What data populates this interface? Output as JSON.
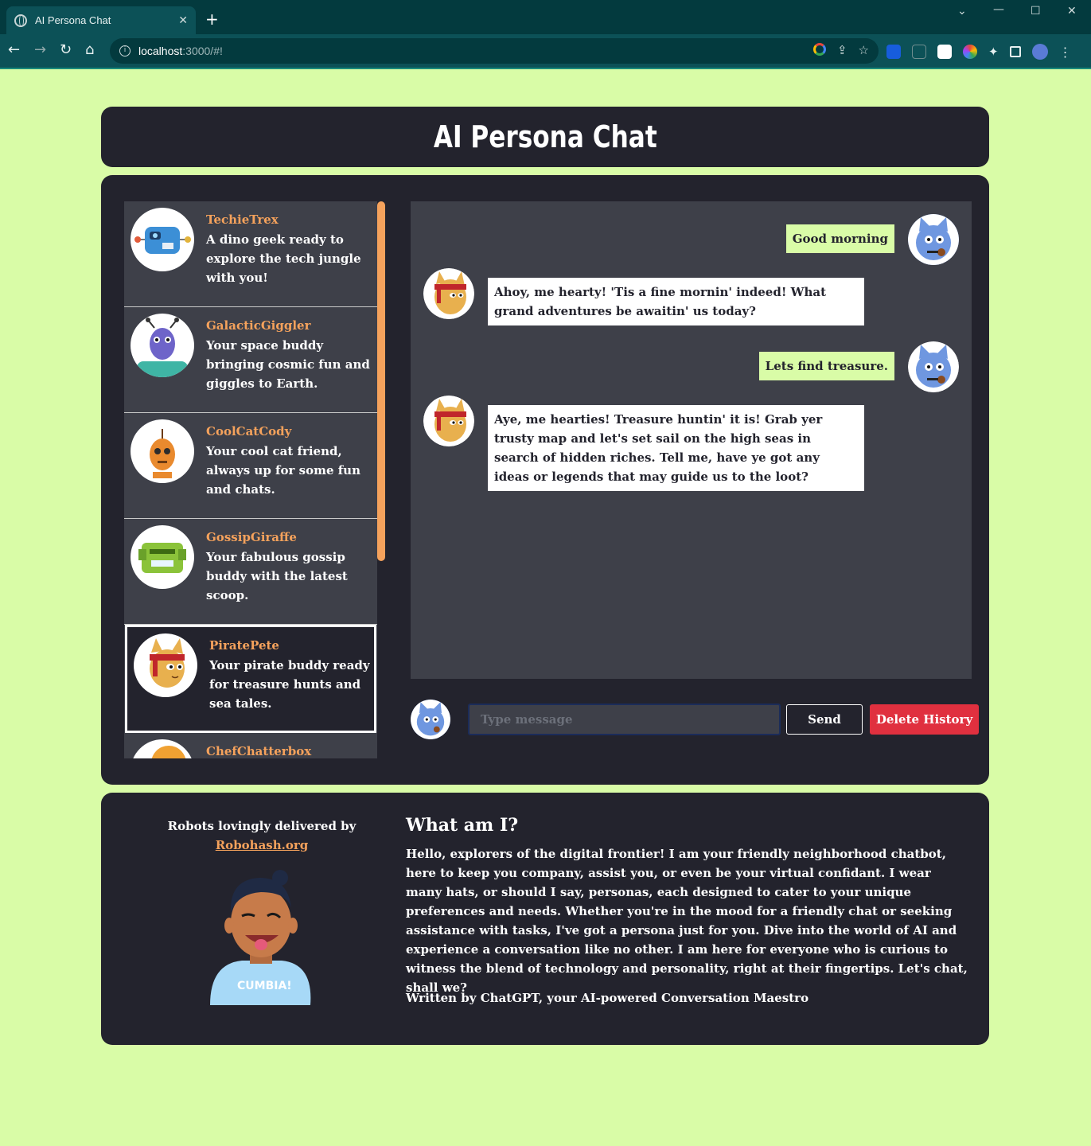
{
  "browser": {
    "tab_title": "AI Persona Chat",
    "tab_close": "✕",
    "new_tab": "+",
    "url_host": "localhost",
    "url_path": ":3000/#!"
  },
  "app": {
    "title": "AI Persona Chat"
  },
  "personas": [
    {
      "name": "TechieTrex",
      "description": "A dino geek ready to explore the tech jungle with you!"
    },
    {
      "name": "GalacticGiggler",
      "description": "Your space buddy bringing cosmic fun and giggles to Earth."
    },
    {
      "name": "CoolCatCody",
      "description": "Your cool cat friend, always up for some fun and chats."
    },
    {
      "name": "GossipGiraffe",
      "description": "Your fabulous gossip buddy with the latest scoop."
    },
    {
      "name": "PiratePete",
      "description": "Your pirate buddy ready for treasure hunts and sea tales."
    },
    {
      "name": "ChefChatterbox",
      "description": ""
    }
  ],
  "messages": [
    {
      "role": "user",
      "text": "Good morning"
    },
    {
      "role": "bot",
      "text": "Ahoy, me hearty! 'Tis a fine mornin' indeed! What grand adventures be awaitin' us today?"
    },
    {
      "role": "user",
      "text": "Lets find treasure."
    },
    {
      "role": "bot",
      "text": "Aye, me hearties! Treasure huntin' it is! Grab yer trusty map and let's set sail on the high seas in search of hidden riches. Tell me, have ye got any ideas or legends that may guide us to the loot?"
    }
  ],
  "composer": {
    "placeholder": "Type message",
    "value": "",
    "send_label": "Send",
    "delete_label": "Delete History"
  },
  "footer": {
    "credit_text": "Robots lovingly delivered by",
    "credit_link": "Robohash.org",
    "shirt_text": "CUMBIA!",
    "about_title": "What am I?",
    "about_body": "Hello, explorers of the digital frontier! I am your friendly neighborhood chatbot, here to keep you company, assist you, or even be your virtual confidant. I wear many hats, or should I say, personas, each designed to cater to your unique preferences and needs. Whether you're in the mood for a friendly chat or seeking assistance with tasks, I've got a persona just for you. Dive into the world of AI and experience a conversation like no other. I am here for everyone who is curious to witness the blend of technology and personality, right at their fingertips. Let's chat, shall we?",
    "about_sign": "Written by ChatGPT, your AI-powered Conversation Maestro"
  },
  "colors": {
    "page_bg": "#d9fca7",
    "panel_bg": "#23232d",
    "accent": "#f5a25c",
    "danger": "#e0303f"
  }
}
